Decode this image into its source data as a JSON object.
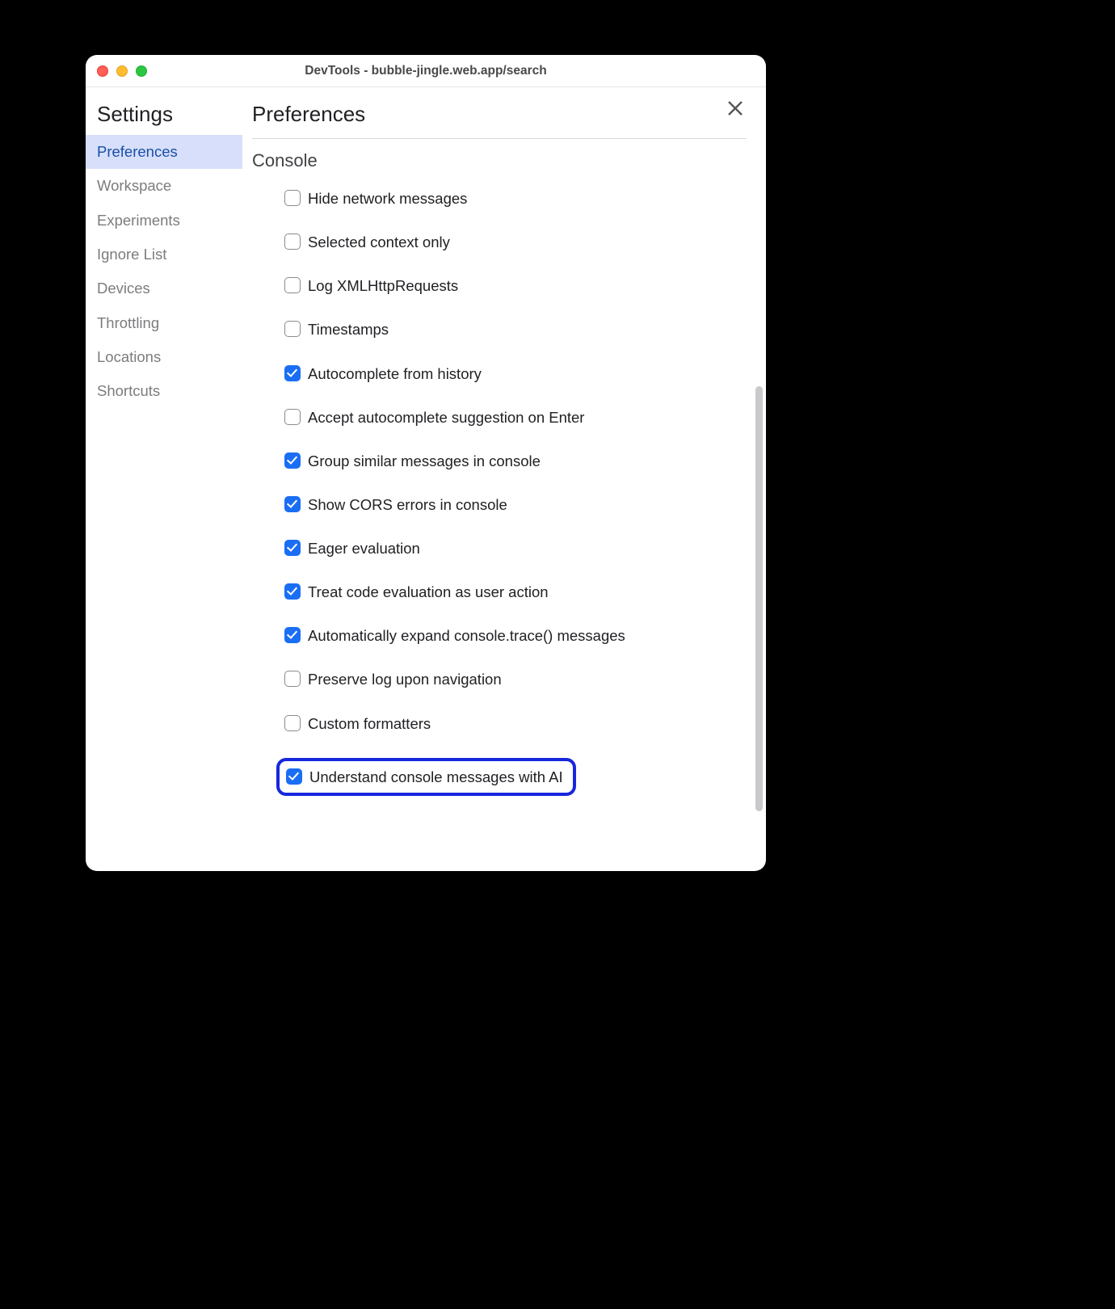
{
  "window": {
    "title": "DevTools - bubble-jingle.web.app/search"
  },
  "sidebar": {
    "title": "Settings",
    "items": [
      {
        "label": "Preferences",
        "active": true
      },
      {
        "label": "Workspace",
        "active": false
      },
      {
        "label": "Experiments",
        "active": false
      },
      {
        "label": "Ignore List",
        "active": false
      },
      {
        "label": "Devices",
        "active": false
      },
      {
        "label": "Throttling",
        "active": false
      },
      {
        "label": "Locations",
        "active": false
      },
      {
        "label": "Shortcuts",
        "active": false
      }
    ]
  },
  "main": {
    "title": "Preferences",
    "section": "Console",
    "options": [
      {
        "label": "Hide network messages",
        "checked": false,
        "highlighted": false
      },
      {
        "label": "Selected context only",
        "checked": false,
        "highlighted": false
      },
      {
        "label": "Log XMLHttpRequests",
        "checked": false,
        "highlighted": false
      },
      {
        "label": "Timestamps",
        "checked": false,
        "highlighted": false
      },
      {
        "label": "Autocomplete from history",
        "checked": true,
        "highlighted": false
      },
      {
        "label": "Accept autocomplete suggestion on Enter",
        "checked": false,
        "highlighted": false
      },
      {
        "label": "Group similar messages in console",
        "checked": true,
        "highlighted": false
      },
      {
        "label": "Show CORS errors in console",
        "checked": true,
        "highlighted": false
      },
      {
        "label": "Eager evaluation",
        "checked": true,
        "highlighted": false
      },
      {
        "label": "Treat code evaluation as user action",
        "checked": true,
        "highlighted": false
      },
      {
        "label": "Automatically expand console.trace() messages",
        "checked": true,
        "highlighted": false
      },
      {
        "label": "Preserve log upon navigation",
        "checked": false,
        "highlighted": false
      },
      {
        "label": "Custom formatters",
        "checked": false,
        "highlighted": false
      },
      {
        "label": "Understand console messages with AI",
        "checked": true,
        "highlighted": true
      }
    ]
  }
}
